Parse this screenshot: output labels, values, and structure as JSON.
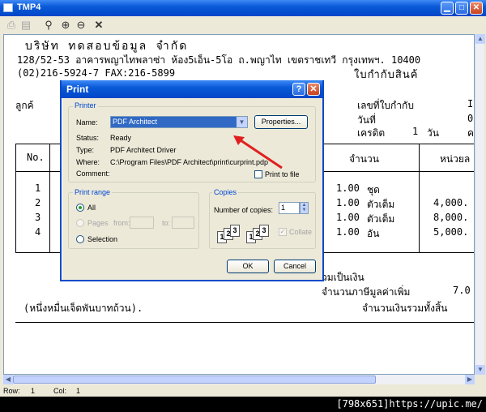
{
  "window": {
    "title": "TMP4",
    "icon": "document-icon"
  },
  "toolbar": {
    "icons": [
      "printer-icon",
      "print-preview-icon",
      "binoculars-icon",
      "zoom-in-icon",
      "zoom-out-icon",
      "close-icon"
    ]
  },
  "document": {
    "company": "บริษัท ทดสอบข้อมูล จำกัด",
    "address": "128/52-53 อาคารพญาไทพลาซ่า ห้อง5เอ็น-5โอ ถ.พญาไท เขตราชเทวี กรุงเทพฯ. 10400",
    "phone": "(02)216-5924-7  FAX:216-5899",
    "doc_type": "ใบกำกับสินค้",
    "customer_label": "ลูกค้",
    "invoice_no_label": "เลขที่ใบกำกับ",
    "invoice_no_value": "I",
    "date_label": "วันที่",
    "date_value": "0",
    "credit_label": "เครดิต",
    "credit_value": "1",
    "credit_unit": "วัน",
    "credit_suffix": "ค",
    "table": {
      "col_no": "No.",
      "col_qty": "จำนวน",
      "col_unit": "หน่วยล",
      "rows": [
        {
          "no": "1",
          "qty": "1.00",
          "unit": "ชุด",
          "price": ""
        },
        {
          "no": "2",
          "qty": "1.00",
          "unit": "ตัวเต็ม",
          "price": "4,000."
        },
        {
          "no": "3",
          "qty": "1.00",
          "unit": "ตัวเต็ม",
          "price": "8,000."
        },
        {
          "no": "4",
          "qty": "1.00",
          "unit": "อัน",
          "price": "5,000."
        }
      ]
    },
    "subtotal_label": "วมเป็นเงิน",
    "vat_label": "จำนวนภาษีมูลค่าเพิ่ม",
    "vat_value": "7.0",
    "amount_words": "(หนึ่งหมื่นเจ็ดพันบาทถ้วน).",
    "grand_total_label": "จำนวนเงินรวมทั้งสิ้น"
  },
  "statusbar": {
    "row_label": "Row:",
    "row_value": "1",
    "col_label": "Col:",
    "col_value": "1"
  },
  "watermark": "[798x651]https://upic.me/",
  "dialog": {
    "title": "Print",
    "printer_group": "Printer",
    "name_label": "Name:",
    "name_value": "PDF Architect",
    "properties_button": "Properties...",
    "status_label": "Status:",
    "status_value": "Ready",
    "type_label": "Type:",
    "type_value": "PDF Architect Driver",
    "where_label": "Where:",
    "where_value": "C:\\Program Files\\PDF Architect\\print\\curprint.pdp",
    "comment_label": "Comment:",
    "print_to_file": "Print to file",
    "range_group": "Print range",
    "all_option": "All",
    "pages_option": "Pages",
    "from_label": "from:",
    "to_label": "to:",
    "selection_option": "Selection",
    "copies_group": "Copies",
    "num_copies_label": "Number of copies:",
    "num_copies_value": "1",
    "collate_label": "Collate",
    "ok_button": "OK",
    "cancel_button": "Cancel"
  },
  "colors": {
    "annotation_arrow": "#e02020",
    "title_bar": "#0a5ad8",
    "selection": "#316ac5"
  }
}
